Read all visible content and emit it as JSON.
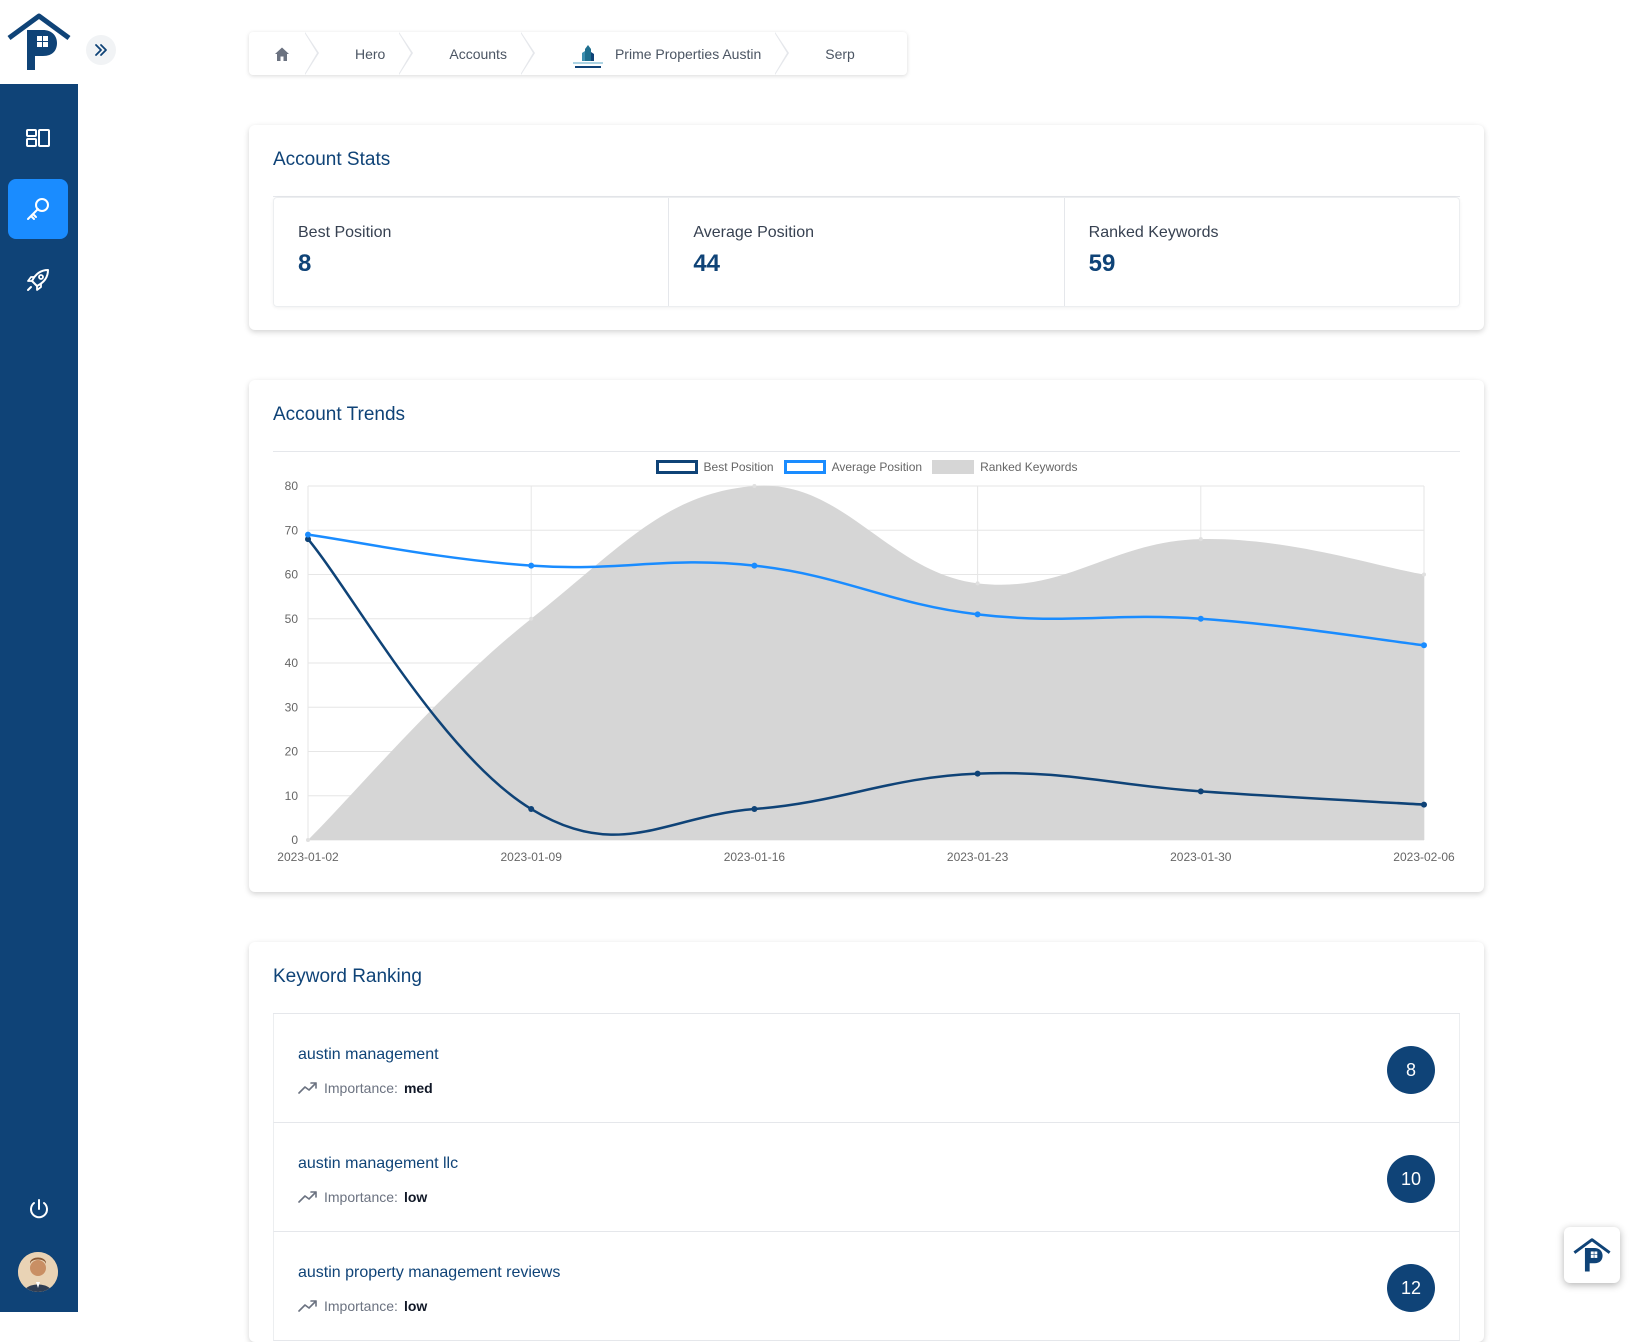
{
  "breadcrumb": {
    "items": [
      {
        "label": ""
      },
      {
        "label": "Hero"
      },
      {
        "label": "Accounts"
      },
      {
        "label": "Prime Properties Austin"
      },
      {
        "label": "Serp"
      }
    ]
  },
  "account_stats": {
    "title": "Account Stats",
    "stats": [
      {
        "label": "Best Position",
        "value": "8"
      },
      {
        "label": "Average Position",
        "value": "44"
      },
      {
        "label": "Ranked Keywords",
        "value": "59"
      }
    ]
  },
  "account_trends": {
    "title": "Account Trends"
  },
  "chart_data": {
    "type": "line",
    "x": [
      "2023-01-02",
      "2023-01-09",
      "2023-01-16",
      "2023-01-23",
      "2023-01-30",
      "2023-02-06"
    ],
    "ylim": [
      0,
      80
    ],
    "yticks": [
      0,
      10,
      20,
      30,
      40,
      50,
      60,
      70,
      80
    ],
    "grid": true,
    "legend_position": "top",
    "series": [
      {
        "name": "Best Position",
        "values": [
          68,
          7,
          7,
          15,
          11,
          8
        ],
        "color": "#0f4377",
        "style": "line"
      },
      {
        "name": "Average Position",
        "values": [
          69,
          62,
          62,
          51,
          50,
          44
        ],
        "color": "#1a8cff",
        "style": "line"
      },
      {
        "name": "Ranked Keywords",
        "values": [
          0,
          50,
          80,
          58,
          68,
          60
        ],
        "color": "#d6d6d6",
        "style": "area"
      }
    ]
  },
  "keyword_ranking": {
    "title": "Keyword Ranking",
    "importance_label": "Importance:",
    "items": [
      {
        "keyword": "austin management",
        "importance": "med",
        "rank": "8"
      },
      {
        "keyword": "austin management llc",
        "importance": "low",
        "rank": "10"
      },
      {
        "keyword": "austin property management reviews",
        "importance": "low",
        "rank": "12"
      }
    ]
  },
  "colors": {
    "brand": "#0f4377",
    "accent": "#1a8cff"
  },
  "icons": {
    "sidebar": [
      "dashboard-icon",
      "key-icon",
      "rocket-icon"
    ],
    "bottom": [
      "power-icon"
    ]
  }
}
